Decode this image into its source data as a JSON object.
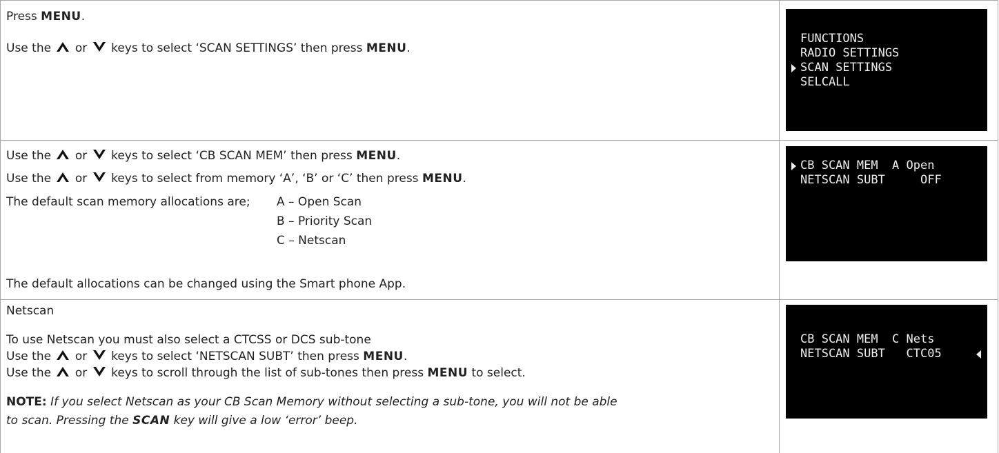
{
  "colors": {
    "border": "#a7a7a7",
    "screen_bg": "#000000",
    "screen_text": "#eeeeee",
    "text": "#222222"
  },
  "icons": {
    "up": "up-arrow-icon",
    "down": "down-arrow-icon"
  },
  "row1": {
    "line1": {
      "pre": "Press ",
      "key": "MENU",
      "post": "."
    },
    "line2": {
      "pre": "Use the ",
      "mid": " or ",
      "post": " keys to select ‘SCAN SETTINGS’ then press ",
      "key": "MENU",
      "end": "."
    },
    "screen": [
      "FUNCTIONS",
      "RADIO SETTINGS",
      "SCAN SETTINGS",
      "SELCALL"
    ]
  },
  "row2": {
    "line1": {
      "pre": "Use the ",
      "mid": " or ",
      "post": " keys to select ‘CB SCAN MEM’ then press ",
      "key": "MENU",
      "end": "."
    },
    "line2": {
      "pre": "Use the ",
      "mid": " or ",
      "post": " keys to select from memory ‘A’, ‘B’ or ‘C’ then press ",
      "key": "MENU",
      "end": "."
    },
    "default_intro": "The default scan memory allocations are;",
    "allocations": [
      "A – Open Scan",
      "B – Priority Scan",
      "C – Netscan"
    ],
    "footer": "The default allocations can be changed using the Smart phone App.",
    "screen": [
      "CB SCAN MEM  A Open",
      "NETSCAN SUBT     OFF"
    ]
  },
  "row3": {
    "heading": "Netscan",
    "line1": "To use Netscan you must also select a CTCSS or DCS sub-tone",
    "line2": {
      "pre": "Use the ",
      "mid": " or ",
      "post": " keys to select ‘NETSCAN SUBT’ then press ",
      "key": "MENU",
      "end": "."
    },
    "line3": {
      "pre": "Use the ",
      "mid": " or ",
      "post": " keys to scroll through the list of sub-tones then press ",
      "key": "MENU",
      "end": " to select."
    },
    "note_label": "NOTE:",
    "note_text1": " If you select Netscan as your CB Scan Memory without selecting a sub-tone, you will not be able",
    "note_text2a": "to scan. Pressing the ",
    "note_key": "SCAN",
    "note_text2b": " key will give a low ‘error’ beep.",
    "screen": [
      "CB SCAN MEM  C Nets",
      "NETSCAN SUBT   CTC05"
    ]
  }
}
